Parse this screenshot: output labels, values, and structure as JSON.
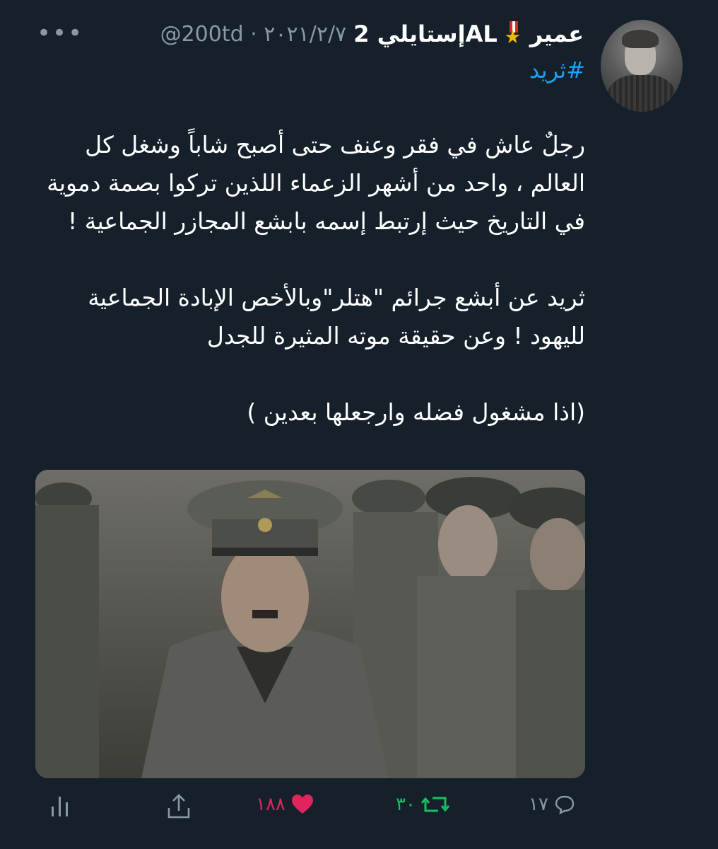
{
  "tweet": {
    "display_name": "عمير",
    "display_name_2": "إستايلي 2AL",
    "handle_date": "@200td · ٢٠٢١/٢/٧",
    "more": "•••",
    "hashtag": "#ثريد",
    "paragraphs": [
      "رجلٌ عاش في فقر وعنف حتى أصبح شاباً وشغل كل العالم ، واحد من أشهر الزعماء اللذين تركوا بصمة دموية في التاريخ حيث إرتبط إسمه بابشع المجازر الجماعية !",
      "ثريد عن أبشع جرائم \"هتلر\"وبالأخص الإبادة الجماعية لليهود ! وعن حقيقة موته المثيرة للجدل",
      "(اذا مشغول فضله وارجعلها بعدين )"
    ]
  },
  "actions": {
    "replies": "١٧",
    "retweets": "٣٠",
    "likes": "١٨٨"
  },
  "colors": {
    "background": "#15202b",
    "link": "#1da1f2",
    "muted": "#8899a6",
    "retweet": "#17bf63",
    "like": "#e0245e"
  }
}
